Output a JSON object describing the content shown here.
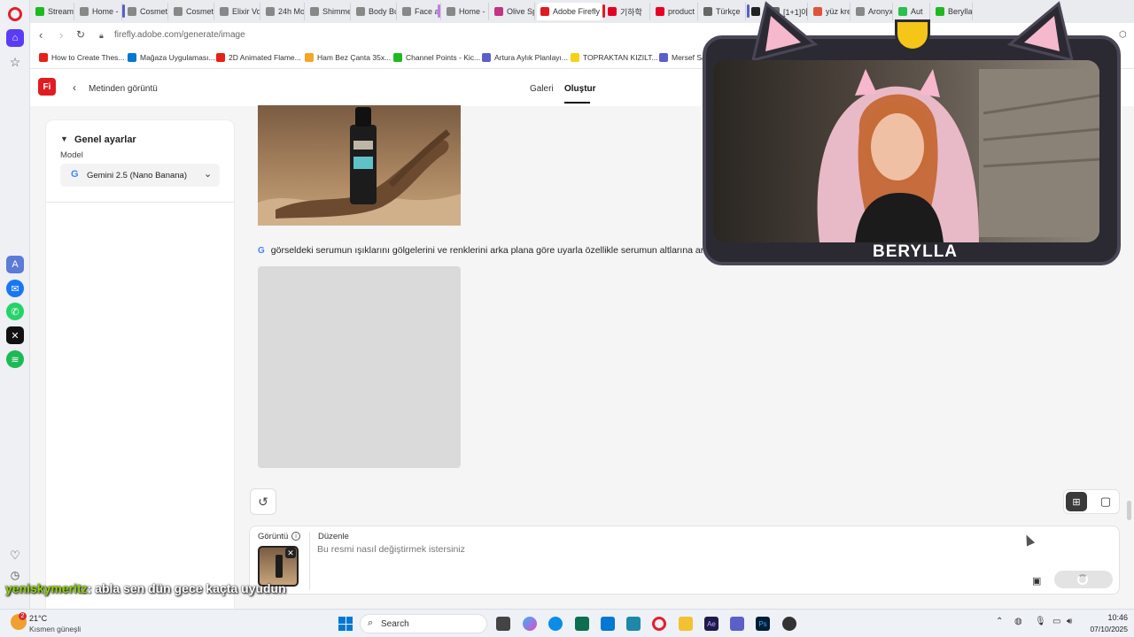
{
  "browser": {
    "tabs": [
      {
        "label": "Stream",
        "fav": "#1fb91f"
      },
      {
        "label": "Home -",
        "fav": "#888"
      },
      {
        "label": "Cosmet",
        "fav": "#888"
      },
      {
        "label": "Cosmeti",
        "fav": "#888"
      },
      {
        "label": "Elixir Vo",
        "fav": "#888"
      },
      {
        "label": "24h Mo",
        "fav": "#888"
      },
      {
        "label": "Shimme",
        "fav": "#888"
      },
      {
        "label": "Body Bu",
        "fav": "#888"
      },
      {
        "label": "Face an",
        "fav": "#888"
      },
      {
        "label": "Home -",
        "fav": "#888"
      },
      {
        "label": "Olive Sp",
        "fav": "#c13584"
      },
      {
        "label": "Adobe Firefly",
        "fav": "#e11b22"
      },
      {
        "label": "기하학",
        "fav": "#e60023"
      },
      {
        "label": "product",
        "fav": "#e60023"
      },
      {
        "label": "Türkçe",
        "fav": "#666"
      },
      {
        "label": "M",
        "fav": "#222"
      },
      {
        "label": "[1+1]아",
        "fav": "#666"
      },
      {
        "label": "yüz krer",
        "fav": "#e0533b"
      },
      {
        "label": "Aronyx",
        "fav": "#888"
      },
      {
        "label": "Aut",
        "fav": "#2bbf4b"
      },
      {
        "label": "Berylla",
        "fav": "#1fb91f"
      }
    ],
    "url": "firefly.adobe.com/generate/image",
    "bookmarks": [
      {
        "label": "How to Create Thes...",
        "fav": "#e62117"
      },
      {
        "label": "Mağaza Uygulaması...",
        "fav": "#0078d4"
      },
      {
        "label": "2D Animated Flame...",
        "fav": "#e62117"
      },
      {
        "label": "Ham Bez Çanta 35x...",
        "fav": "#f5a623"
      },
      {
        "label": "Channel Points - Kic...",
        "fav": "#1fb91f"
      },
      {
        "label": "Artura Aylık Planlayı...",
        "fav": "#5b5fc7"
      },
      {
        "label": "TOPRAKTAN KIZILT...",
        "fav": "#f7d117"
      },
      {
        "label": "Mersef Sa",
        "fav": "#5b5fc7"
      }
    ]
  },
  "firefly": {
    "logo": "Fi",
    "back_label": "Metinden görüntü",
    "nav": {
      "gallery": "Galeri",
      "create": "Oluştur"
    },
    "settings": {
      "section_title": "Genel ayarlar",
      "model_label": "Model",
      "model_value": "Gemini 2.5 (Nano Banana)"
    },
    "prompt_text": "görseldeki serumun ışıklarını gölgelerini ve renklerini arka plana göre uyarla özellikle serumun altlarına arka planla",
    "composer": {
      "image_label": "Görüntü",
      "edit_label": "Düzenle",
      "placeholder": "Bu resmi nasıl değiştirmek istersiniz"
    }
  },
  "overlay": {
    "streamer_name": "BERYLLA",
    "chat": {
      "user": "yeniskymeritz",
      "message": ": abla sen dün gece kaçta uyudun",
      "user_color": "#8fd400"
    }
  },
  "taskbar": {
    "weather_temp": "21°C",
    "weather_desc": "Kısmen güneşli",
    "weather_badge": "2",
    "search_label": "Search",
    "time": "10:46",
    "date": "07/10/2025"
  },
  "colors": {
    "firefly_red": "#e11b22",
    "opera_red": "#e0202e",
    "overlay_pink": "#f6b8cc"
  }
}
